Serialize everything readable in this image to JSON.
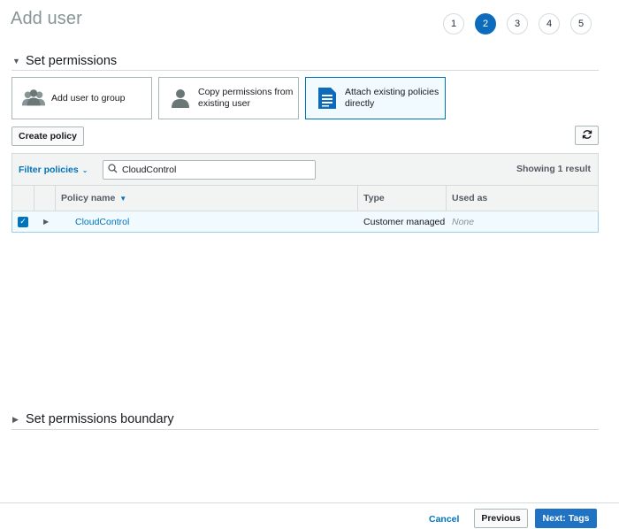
{
  "page": {
    "title": "Add user"
  },
  "steps": [
    "1",
    "2",
    "3",
    "4",
    "5"
  ],
  "active_step": "2",
  "permissions_section": {
    "title": "Set permissions",
    "options": [
      {
        "label": "Add user to group",
        "icon": "users-group-icon",
        "selected": false
      },
      {
        "label": "Copy permissions from existing user",
        "icon": "user-icon",
        "selected": false
      },
      {
        "label": "Attach existing policies directly",
        "icon": "document-icon",
        "selected": true
      }
    ],
    "create_policy_label": "Create policy",
    "refresh_icon": "refresh-icon"
  },
  "policy_table": {
    "filter_label": "Filter policies",
    "search_value": "CloudControl",
    "showing_text": "Showing 1 result",
    "columns": [
      "Policy name",
      "Type",
      "Used as"
    ],
    "rows": [
      {
        "checked": true,
        "name": "CloudControl",
        "type": "Customer managed",
        "used_as": "None"
      }
    ]
  },
  "boundary_section": {
    "title": "Set permissions boundary"
  },
  "footer": {
    "cancel_label": "Cancel",
    "previous_label": "Previous",
    "next_label": "Next: Tags"
  },
  "colors": {
    "accent": "#0073bb",
    "active_step": "#0d6bbd",
    "primary_button": "#1f73c2"
  }
}
